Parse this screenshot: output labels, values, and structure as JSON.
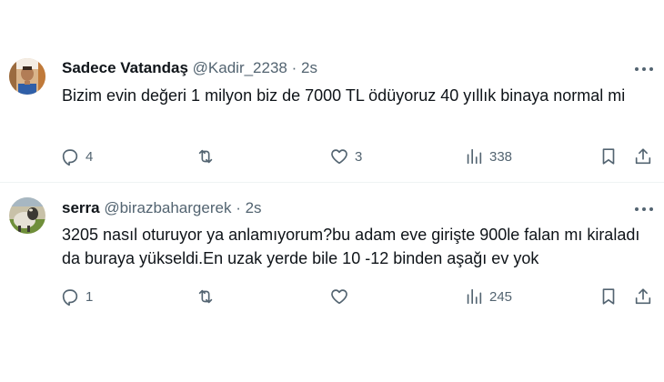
{
  "tweets": [
    {
      "display_name": "Sadece Vatandaş",
      "handle": "@Kadir_2238",
      "separator": "·",
      "time": "2s",
      "text": "Bizim evin değeri 1 milyon biz de 7000 TL ödüyoruz 40 yıllık binaya normal mi",
      "replies": "4",
      "retweets": "",
      "likes": "3",
      "views": "338"
    },
    {
      "display_name": "serra",
      "handle": "@birazbahargerek",
      "separator": "·",
      "time": "2s",
      "text": "3205 nasıl oturuyor ya anlamıyorum?bu adam eve girişte 900le falan mı kiraladı da buraya yükseldi.En uzak yerde bile 10 -12 binden aşağı ev yok",
      "replies": "1",
      "retweets": "",
      "likes": "",
      "views": "245"
    }
  ],
  "icons": {
    "reply": "reply-icon",
    "retweet": "retweet-icon",
    "like": "heart-icon",
    "views": "views-chart-icon",
    "bookmark": "bookmark-icon",
    "share": "share-icon",
    "more": "more-dots-icon"
  },
  "colors": {
    "text": "#0f1419",
    "secondary": "#536471",
    "divider": "#eff3f4"
  }
}
